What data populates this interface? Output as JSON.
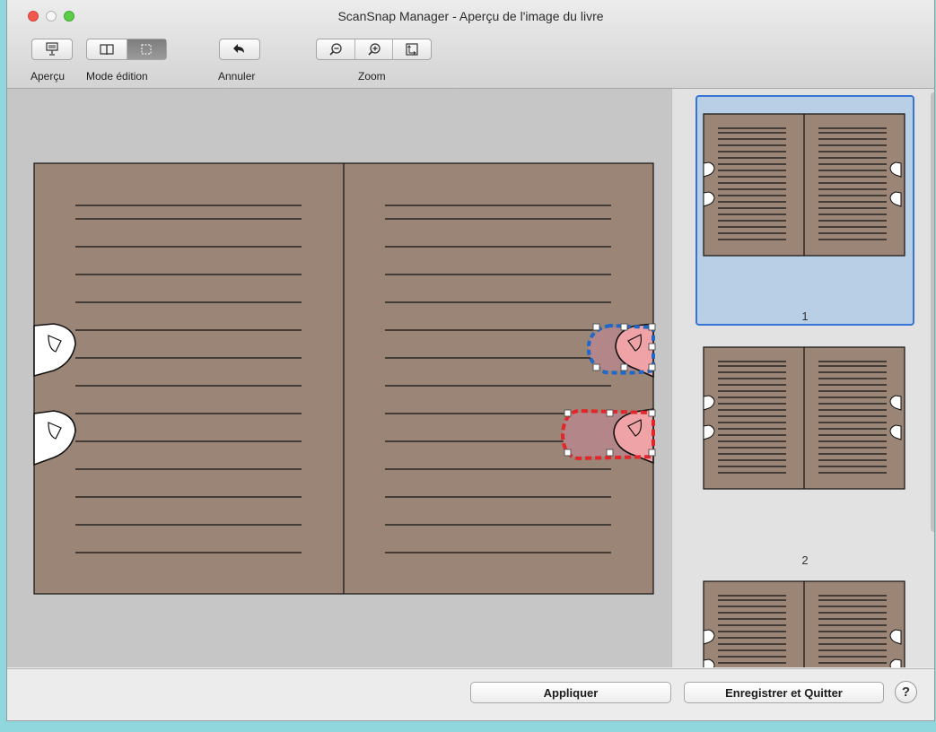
{
  "window": {
    "title": "ScanSnap Manager - Aperçu de l'image du livre"
  },
  "toolbar": {
    "apercu_label": "Aperçu",
    "mode_edition_label": "Mode édition",
    "annuler_label": "Annuler",
    "zoom_label": "Zoom"
  },
  "thumbnails": {
    "page1_number": "1",
    "page2_number": "2"
  },
  "footer": {
    "apply_label": "Appliquer",
    "save_quit_label": "Enregistrer et Quitter",
    "help_label": "?"
  },
  "colors": {
    "page": "#9a8576",
    "selection_fill": "#b3868a",
    "finger_fill": "#f0a3a6",
    "marquee_blue": "#1f67c8",
    "marquee_red": "#e3262b"
  }
}
